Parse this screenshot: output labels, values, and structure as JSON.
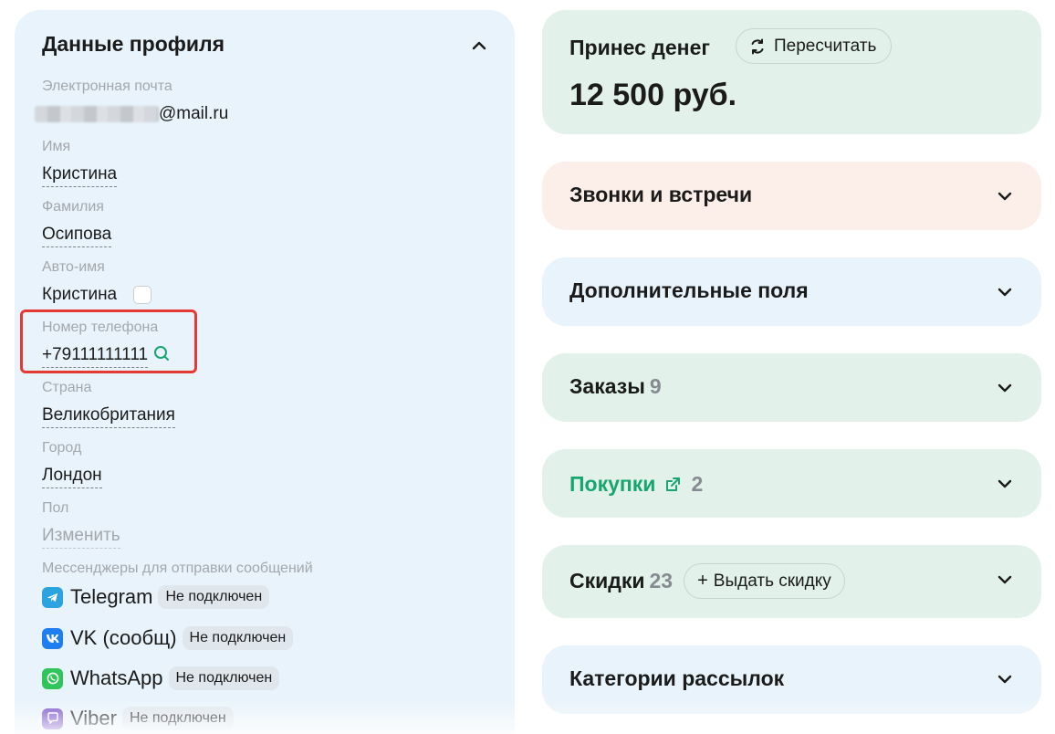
{
  "profile": {
    "title": "Данные профиля",
    "email": {
      "label": "Электронная почта",
      "suffix": "@mail.ru"
    },
    "first_name": {
      "label": "Имя",
      "value": "Кристина"
    },
    "last_name": {
      "label": "Фамилия",
      "value": "Осипова"
    },
    "auto_name": {
      "label": "Авто-имя",
      "value": "Кристина"
    },
    "phone": {
      "label": "Номер телефона",
      "value": "+79111111111"
    },
    "country": {
      "label": "Страна",
      "value": "Великобритания"
    },
    "city": {
      "label": "Город",
      "value": "Лондон"
    },
    "gender": {
      "label": "Пол",
      "value": "Изменить"
    },
    "messengers": {
      "label": "Мессенджеры для отправки сообщений",
      "items": [
        {
          "name": "Telegram",
          "status": "Не подключен",
          "icon": "telegram-icon",
          "color": "#2aa3e0"
        },
        {
          "name": "VK (сообщ)",
          "status": "Не подключен",
          "icon": "vk-icon",
          "color": "#1f7ff0"
        },
        {
          "name": "WhatsApp",
          "status": "Не подключен",
          "icon": "whatsapp-icon",
          "color": "#2fc55a"
        },
        {
          "name": "Viber",
          "status": "Не подключен",
          "icon": "viber-icon",
          "color": "#7a54c8"
        }
      ]
    }
  },
  "cards": {
    "money": {
      "title": "Принес денег",
      "recalc_label": "Пересчитать",
      "amount": "12 500 руб."
    },
    "calls": {
      "title": "Звонки и встречи"
    },
    "fields": {
      "title": "Дополнительные поля"
    },
    "orders": {
      "title": "Заказы",
      "count": "9"
    },
    "purchases": {
      "title": "Покупки",
      "count": "2"
    },
    "discounts": {
      "title": "Скидки",
      "count": "23",
      "button_label": "Выдать скидку"
    },
    "mailing": {
      "title": "Категории рассылок"
    }
  },
  "colors": {
    "accent_green": "#17a670",
    "highlight_red": "#e53935",
    "profile_bg": "#e8f3fb",
    "green_card_bg": "#e2f2ea",
    "peach_card_bg": "#fcefe9",
    "blue_card_bg": "#e8f3fb"
  }
}
